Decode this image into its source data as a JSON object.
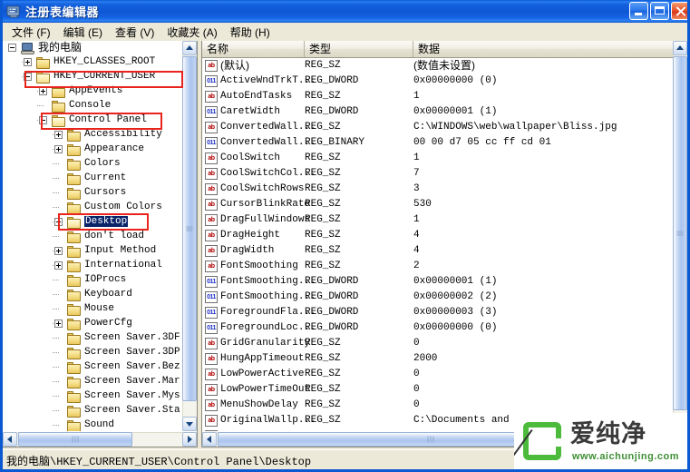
{
  "window": {
    "title": "注册表编辑器",
    "icon": "registry-editor-icon",
    "buttons": {
      "minimize": "minimize-button",
      "maximize": "maximize-button",
      "close": "close-button"
    }
  },
  "menubar": {
    "items": [
      {
        "label": "文件 (F)"
      },
      {
        "label": "编辑 (E)"
      },
      {
        "label": "查看 (V)"
      },
      {
        "label": "收藏夹 (A)"
      },
      {
        "label": "帮助 (H)"
      }
    ]
  },
  "tree": {
    "nodes": [
      {
        "label": "我的电脑",
        "indent": 0,
        "toggle": "minus",
        "icon": "computer",
        "selected": false,
        "chinese": true
      },
      {
        "label": "HKEY_CLASSES_ROOT",
        "indent": 1,
        "toggle": "plus",
        "icon": "folder",
        "selected": false,
        "chinese": false
      },
      {
        "label": "HKEY_CURRENT_USER",
        "indent": 1,
        "toggle": "minus",
        "icon": "folder-open",
        "selected": false,
        "chinese": false
      },
      {
        "label": "AppEvents",
        "indent": 2,
        "toggle": "plus",
        "icon": "folder",
        "selected": false,
        "chinese": false
      },
      {
        "label": "Console",
        "indent": 2,
        "toggle": "none",
        "icon": "folder",
        "selected": false,
        "chinese": false
      },
      {
        "label": "Control Panel",
        "indent": 2,
        "toggle": "minus",
        "icon": "folder-open",
        "selected": false,
        "chinese": false
      },
      {
        "label": "Accessibility",
        "indent": 3,
        "toggle": "plus",
        "icon": "folder",
        "selected": false,
        "chinese": false
      },
      {
        "label": "Appearance",
        "indent": 3,
        "toggle": "plus",
        "icon": "folder",
        "selected": false,
        "chinese": false
      },
      {
        "label": "Colors",
        "indent": 3,
        "toggle": "none",
        "icon": "folder",
        "selected": false,
        "chinese": false
      },
      {
        "label": "Current",
        "indent": 3,
        "toggle": "none",
        "icon": "folder",
        "selected": false,
        "chinese": false
      },
      {
        "label": "Cursors",
        "indent": 3,
        "toggle": "none",
        "icon": "folder",
        "selected": false,
        "chinese": false
      },
      {
        "label": "Custom Colors",
        "indent": 3,
        "toggle": "none",
        "icon": "folder",
        "selected": false,
        "chinese": false
      },
      {
        "label": "Desktop",
        "indent": 3,
        "toggle": "plus",
        "icon": "folder-open",
        "selected": true,
        "chinese": false
      },
      {
        "label": "don't load",
        "indent": 3,
        "toggle": "none",
        "icon": "folder",
        "selected": false,
        "chinese": false
      },
      {
        "label": "Input Method",
        "indent": 3,
        "toggle": "plus",
        "icon": "folder",
        "selected": false,
        "chinese": false
      },
      {
        "label": "International",
        "indent": 3,
        "toggle": "plus",
        "icon": "folder",
        "selected": false,
        "chinese": false
      },
      {
        "label": "IOProcs",
        "indent": 3,
        "toggle": "none",
        "icon": "folder",
        "selected": false,
        "chinese": false
      },
      {
        "label": "Keyboard",
        "indent": 3,
        "toggle": "none",
        "icon": "folder",
        "selected": false,
        "chinese": false
      },
      {
        "label": "Mouse",
        "indent": 3,
        "toggle": "none",
        "icon": "folder",
        "selected": false,
        "chinese": false
      },
      {
        "label": "PowerCfg",
        "indent": 3,
        "toggle": "plus",
        "icon": "folder",
        "selected": false,
        "chinese": false
      },
      {
        "label": "Screen Saver.3DF",
        "indent": 3,
        "toggle": "none",
        "icon": "folder",
        "selected": false,
        "chinese": false
      },
      {
        "label": "Screen Saver.3DP",
        "indent": 3,
        "toggle": "none",
        "icon": "folder",
        "selected": false,
        "chinese": false
      },
      {
        "label": "Screen Saver.Bez",
        "indent": 3,
        "toggle": "none",
        "icon": "folder",
        "selected": false,
        "chinese": false
      },
      {
        "label": "Screen Saver.Mar",
        "indent": 3,
        "toggle": "none",
        "icon": "folder",
        "selected": false,
        "chinese": false
      },
      {
        "label": "Screen Saver.Mys",
        "indent": 3,
        "toggle": "none",
        "icon": "folder",
        "selected": false,
        "chinese": false
      },
      {
        "label": "Screen Saver.Sta",
        "indent": 3,
        "toggle": "none",
        "icon": "folder",
        "selected": false,
        "chinese": false
      },
      {
        "label": "Sound",
        "indent": 3,
        "toggle": "none",
        "icon": "folder",
        "selected": false,
        "chinese": false
      }
    ]
  },
  "list": {
    "columns": [
      {
        "label": "名称"
      },
      {
        "label": "类型"
      },
      {
        "label": "数据"
      }
    ],
    "rows": [
      {
        "icon": "string-value-icon",
        "name": "(默认)",
        "type": "REG_SZ",
        "data": "(数值未设置)",
        "chinese": true
      },
      {
        "icon": "binary-value-icon",
        "name": "ActiveWndTrkT...",
        "type": "REG_DWORD",
        "data": "0x00000000  (0)",
        "chinese": false
      },
      {
        "icon": "string-value-icon",
        "name": "AutoEndTasks",
        "type": "REG_SZ",
        "data": "1",
        "chinese": false
      },
      {
        "icon": "binary-value-icon",
        "name": "CaretWidth",
        "type": "REG_DWORD",
        "data": "0x00000001  (1)",
        "chinese": false
      },
      {
        "icon": "string-value-icon",
        "name": "ConvertedWall...",
        "type": "REG_SZ",
        "data": "C:\\WINDOWS\\web\\wallpaper\\Bliss.jpg",
        "chinese": false
      },
      {
        "icon": "binary-value-icon",
        "name": "ConvertedWall...",
        "type": "REG_BINARY",
        "data": "00 00 d7 05 cc ff cd 01",
        "chinese": false
      },
      {
        "icon": "string-value-icon",
        "name": "CoolSwitch",
        "type": "REG_SZ",
        "data": "1",
        "chinese": false
      },
      {
        "icon": "string-value-icon",
        "name": "CoolSwitchCol...",
        "type": "REG_SZ",
        "data": "7",
        "chinese": false
      },
      {
        "icon": "string-value-icon",
        "name": "CoolSwitchRows",
        "type": "REG_SZ",
        "data": "3",
        "chinese": false
      },
      {
        "icon": "string-value-icon",
        "name": "CursorBlinkRate",
        "type": "REG_SZ",
        "data": "530",
        "chinese": false
      },
      {
        "icon": "string-value-icon",
        "name": "DragFullWindows",
        "type": "REG_SZ",
        "data": "1",
        "chinese": false
      },
      {
        "icon": "string-value-icon",
        "name": "DragHeight",
        "type": "REG_SZ",
        "data": "4",
        "chinese": false
      },
      {
        "icon": "string-value-icon",
        "name": "DragWidth",
        "type": "REG_SZ",
        "data": "4",
        "chinese": false
      },
      {
        "icon": "string-value-icon",
        "name": "FontSmoothing",
        "type": "REG_SZ",
        "data": "2",
        "chinese": false
      },
      {
        "icon": "binary-value-icon",
        "name": "FontSmoothing...",
        "type": "REG_DWORD",
        "data": "0x00000001  (1)",
        "chinese": false
      },
      {
        "icon": "binary-value-icon",
        "name": "FontSmoothing...",
        "type": "REG_DWORD",
        "data": "0x00000002  (2)",
        "chinese": false
      },
      {
        "icon": "binary-value-icon",
        "name": "ForegroundFla...",
        "type": "REG_DWORD",
        "data": "0x00000003  (3)",
        "chinese": false
      },
      {
        "icon": "binary-value-icon",
        "name": "ForegroundLoc...",
        "type": "REG_DWORD",
        "data": "0x00000000  (0)",
        "chinese": false
      },
      {
        "icon": "string-value-icon",
        "name": "GridGranularity",
        "type": "REG_SZ",
        "data": "0",
        "chinese": false
      },
      {
        "icon": "string-value-icon",
        "name": "HungAppTimeout",
        "type": "REG_SZ",
        "data": "2000",
        "chinese": false
      },
      {
        "icon": "string-value-icon",
        "name": "LowPowerActive",
        "type": "REG_SZ",
        "data": "0",
        "chinese": false
      },
      {
        "icon": "string-value-icon",
        "name": "LowPowerTimeOut",
        "type": "REG_SZ",
        "data": "0",
        "chinese": false
      },
      {
        "icon": "string-value-icon",
        "name": "MenuShowDelay",
        "type": "REG_SZ",
        "data": "0",
        "chinese": false
      },
      {
        "icon": "string-value-icon",
        "name": "OriginalWallp...",
        "type": "REG_SZ",
        "data": "C:\\Documents and",
        "chinese": false
      }
    ]
  },
  "statusbar": {
    "path": "我的电脑\\HKEY_CURRENT_USER\\Control Panel\\Desktop"
  },
  "watermark": {
    "brand": "爱纯净",
    "url": "www.aichunjing.com",
    "accent": "#4cbb3c"
  },
  "annotations": {
    "color": "#e8241d",
    "boxes": [
      {
        "target": "HKEY_CURRENT_USER"
      },
      {
        "target": "Control Panel"
      },
      {
        "target": "Desktop"
      }
    ]
  },
  "icons": {
    "value_string": "ab",
    "value_binary": "011"
  }
}
